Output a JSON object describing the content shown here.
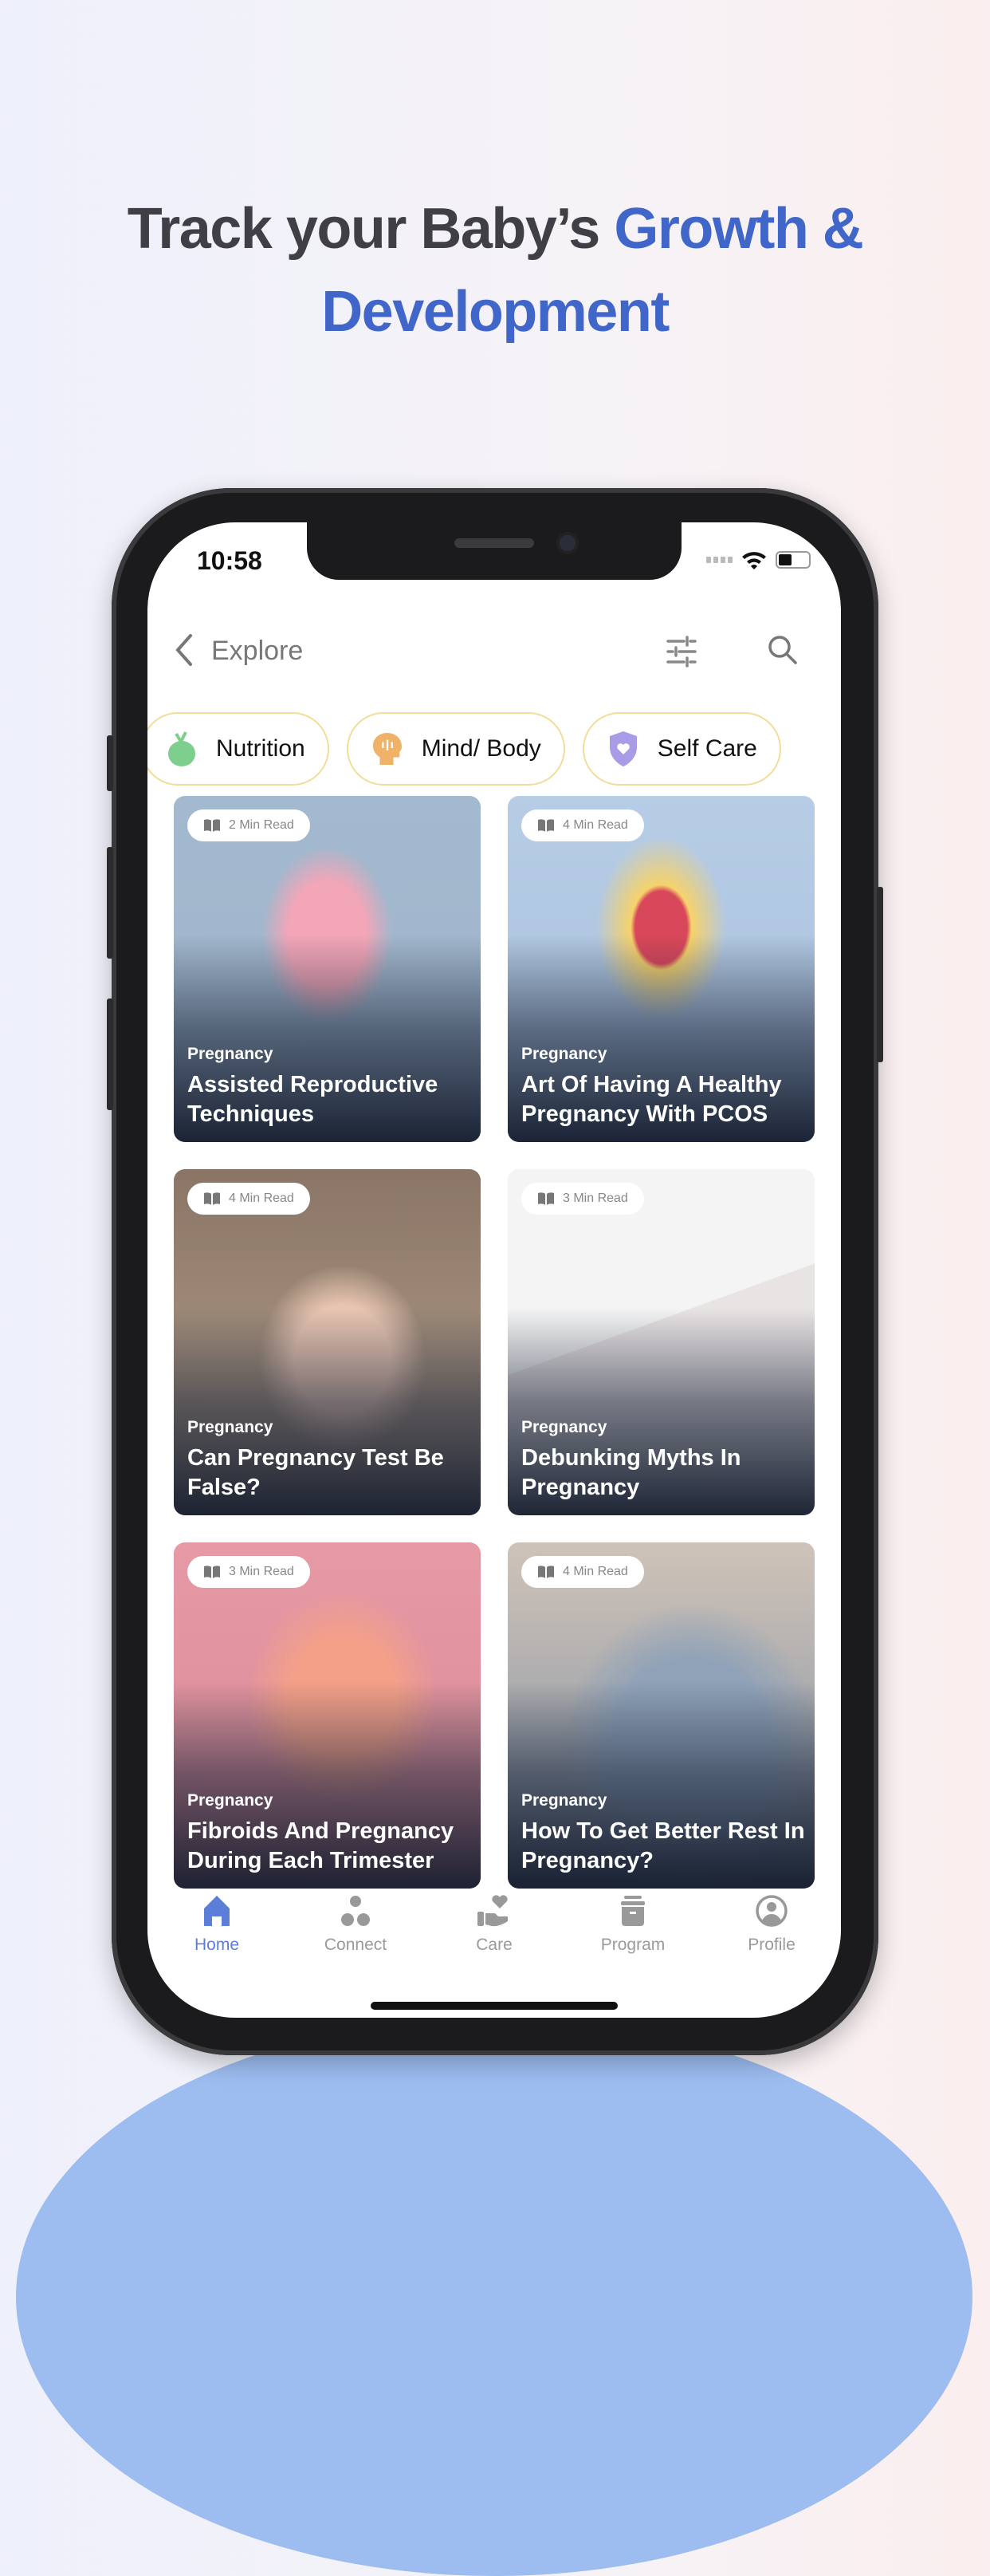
{
  "headline": {
    "part1": "Track your Baby’s ",
    "accent1": "Growth &",
    "accent2": "Development"
  },
  "status_bar": {
    "time": "10:58"
  },
  "header": {
    "title": "Explore"
  },
  "chips": [
    {
      "label": "Nutrition",
      "icon": "apple-icon",
      "color": "#7ecf8e"
    },
    {
      "label": "Mind/ Body",
      "icon": "head-icon",
      "color": "#f0b268"
    },
    {
      "label": "Self Care",
      "icon": "shield-heart-icon",
      "color": "#a99be6"
    }
  ],
  "articles": [
    {
      "read": "2 Min Read",
      "category": "Pregnancy",
      "title": "Assisted Reproductive Techniques"
    },
    {
      "read": "4 Min Read",
      "category": "Pregnancy",
      "title": "Art Of Having A Healthy Pregnancy With PCOS"
    },
    {
      "read": "4 Min Read",
      "category": "Pregnancy",
      "title": "Can Pregnancy Test Be False?"
    },
    {
      "read": "3 Min Read",
      "category": "Pregnancy",
      "title": "Debunking Myths In Pregnancy"
    },
    {
      "read": "3 Min Read",
      "category": "Pregnancy",
      "title": "Fibroids And Pregnancy During Each Trimester"
    },
    {
      "read": "4 Min Read",
      "category": "Pregnancy",
      "title": "How To Get Better Rest In Pregnancy?"
    }
  ],
  "tabs": [
    {
      "label": "Home",
      "icon": "home-icon",
      "active": true
    },
    {
      "label": "Connect",
      "icon": "connect-icon"
    },
    {
      "label": "Care",
      "icon": "care-icon"
    },
    {
      "label": "Program",
      "icon": "program-icon"
    },
    {
      "label": "Profile",
      "icon": "profile-icon"
    }
  ],
  "colors": {
    "accent": "#3f66c8",
    "active_tab": "#5b7fd8",
    "chip_border": "#f1dd9a"
  }
}
